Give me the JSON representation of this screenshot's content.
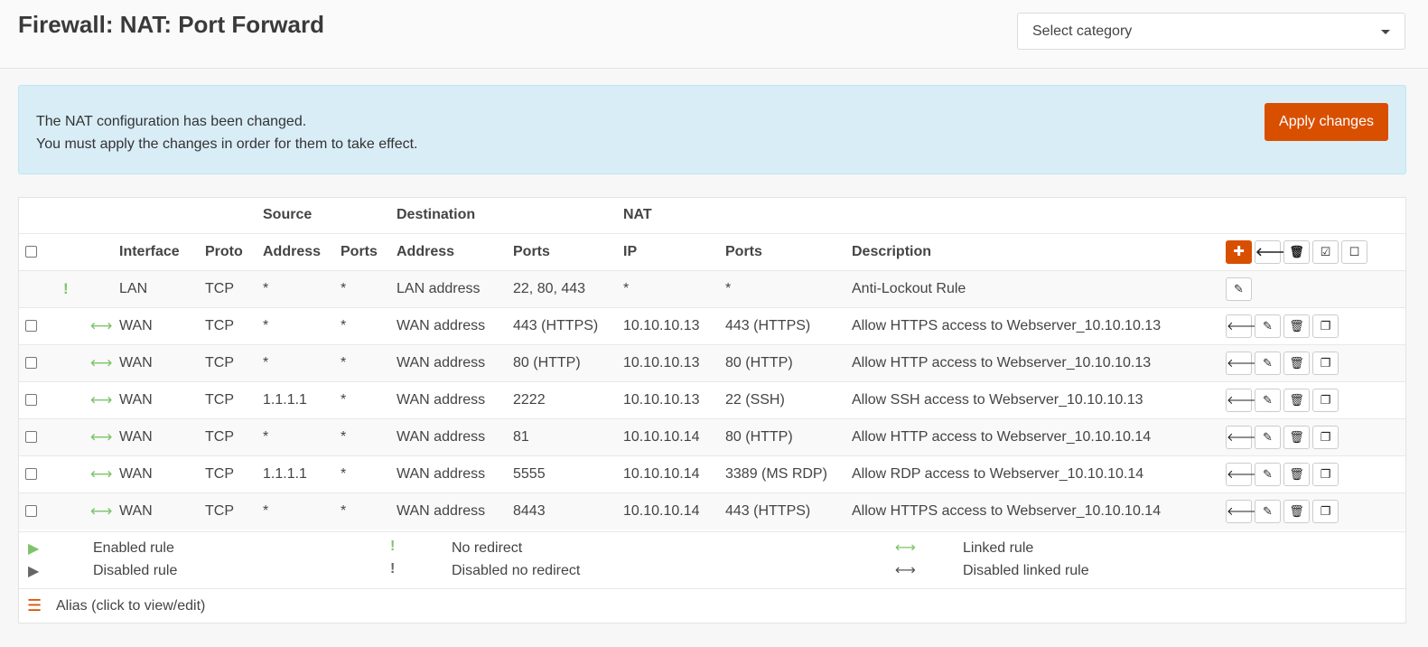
{
  "page": {
    "title": "Firewall: NAT: Port Forward"
  },
  "category_select": {
    "placeholder": "Select category"
  },
  "alert": {
    "line1": "The NAT configuration has been changed.",
    "line2": "You must apply the changes in order for them to take effect.",
    "apply_label": "Apply changes"
  },
  "table": {
    "groups": {
      "source": "Source",
      "destination": "Destination",
      "nat": "NAT"
    },
    "columns": {
      "interface": "Interface",
      "proto": "Proto",
      "src_address": "Address",
      "src_ports": "Ports",
      "dst_address": "Address",
      "dst_ports": "Ports",
      "nat_ip": "IP",
      "nat_ports": "Ports",
      "description": "Description"
    },
    "header_actions": [
      "plus-icon",
      "arrow-left-icon",
      "trash-icon",
      "check-square-icon",
      "square-icon"
    ],
    "rows": [
      {
        "type": "anti-lockout",
        "interface": "LAN",
        "proto": "TCP",
        "src_address": "*",
        "src_ports": "*",
        "dst_address": "LAN address",
        "dst_ports": "22, 80, 443",
        "nat_ip": "*",
        "nat_ports": "*",
        "description": "Anti-Lockout Rule"
      },
      {
        "type": "linked",
        "interface": "WAN",
        "proto": "TCP",
        "src_address": "*",
        "src_ports": "*",
        "dst_address": "WAN address",
        "dst_ports": "443 (HTTPS)",
        "nat_ip": "10.10.10.13",
        "nat_ports": "443 (HTTPS)",
        "description": "Allow HTTPS access to Webserver_10.10.10.13"
      },
      {
        "type": "linked",
        "interface": "WAN",
        "proto": "TCP",
        "src_address": "*",
        "src_ports": "*",
        "dst_address": "WAN address",
        "dst_ports": "80 (HTTP)",
        "nat_ip": "10.10.10.13",
        "nat_ports": "80 (HTTP)",
        "description": "Allow HTTP access to Webserver_10.10.10.13"
      },
      {
        "type": "linked",
        "interface": "WAN",
        "proto": "TCP",
        "src_address": "1.1.1.1",
        "src_ports": "*",
        "dst_address": "WAN address",
        "dst_ports": "2222",
        "nat_ip": "10.10.10.13",
        "nat_ports": "22 (SSH)",
        "description": "Allow SSH access to Webserver_10.10.10.13"
      },
      {
        "type": "linked",
        "interface": "WAN",
        "proto": "TCP",
        "src_address": "*",
        "src_ports": "*",
        "dst_address": "WAN address",
        "dst_ports": "81",
        "nat_ip": "10.10.10.14",
        "nat_ports": "80 (HTTP)",
        "description": "Allow HTTP access to Webserver_10.10.10.14"
      },
      {
        "type": "linked",
        "interface": "WAN",
        "proto": "TCP",
        "src_address": "1.1.1.1",
        "src_ports": "*",
        "dst_address": "WAN address",
        "dst_ports": "5555",
        "nat_ip": "10.10.10.14",
        "nat_ports": "3389 (MS RDP)",
        "description": "Allow RDP access to Webserver_10.10.10.14"
      },
      {
        "type": "linked",
        "interface": "WAN",
        "proto": "TCP",
        "src_address": "*",
        "src_ports": "*",
        "dst_address": "WAN address",
        "dst_ports": "8443",
        "nat_ip": "10.10.10.14",
        "nat_ports": "443 (HTTPS)",
        "description": "Allow HTTPS access to Webserver_10.10.10.14"
      }
    ]
  },
  "legend": {
    "enabled_rule": "Enabled rule",
    "disabled_rule": "Disabled rule",
    "no_redirect": "No redirect",
    "disabled_no_redirect": "Disabled no redirect",
    "linked_rule": "Linked rule",
    "disabled_linked_rule": "Disabled linked rule",
    "alias": "Alias (click to view/edit)"
  },
  "colors": {
    "accent": "#d94f00",
    "enabled": "#7dc36b",
    "disabled": "#666666",
    "alert_bg": "#d9edf7"
  }
}
